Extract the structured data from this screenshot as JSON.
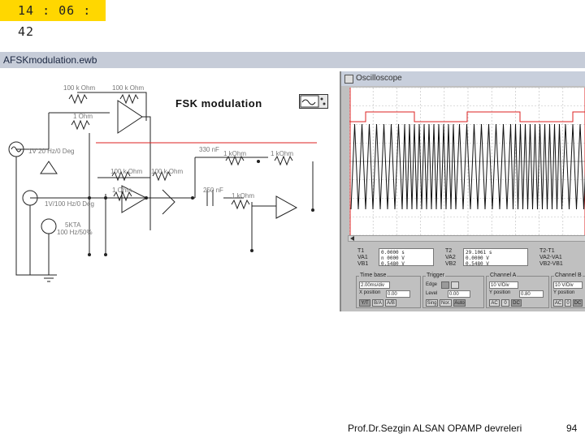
{
  "clock": "14 : 06 : 42",
  "window_title": "AFSKmodulation.ewb",
  "diagram_label": "FSK modulation",
  "components": {
    "r1": "100 k Ohm",
    "r2": "100 k Ohm",
    "r3": "1 Ohm",
    "r4": "1 Ohm",
    "r5": "100 k Ohm",
    "r6": "100 k Ohm",
    "r7": "1 kOhm",
    "r8": "1 kOhm",
    "r9": "1 kOhm",
    "c1": "330 nF",
    "c2": "250 nF",
    "src1": "1V 20 Hz/0 Deg",
    "src2": "1V/100 Hz/0 Deg",
    "clock_src": "5KTA",
    "clock_src2": "100 Hz/50%"
  },
  "scope": {
    "title": "Oscilloscope",
    "readouts": {
      "t1_label": "T1",
      "t2_label": "T2",
      "t2t1_label": "T2-T1",
      "vA1_label": "VA1",
      "vB1_label": "VB1",
      "vA2_label": "VA2",
      "vB2_label": "VB2",
      "vA2A1_label": "VA2-VA1",
      "vB2B1_label": "VB2-VB1",
      "t1_values": [
        "0.0000 s",
        "n 0000 V",
        "0.5480 V"
      ],
      "t2_values": [
        "29.1061 s",
        "0.0000 V",
        "0.5480 V"
      ]
    },
    "timebase": {
      "label": "Time base",
      "value": "2.00ms/div",
      "xpos_label": "X position",
      "xpos": "0.00",
      "buttons": [
        "Y/T",
        "B/A",
        "A/B"
      ]
    },
    "trigger": {
      "label": "Trigger",
      "edge_label": "Edge",
      "level_label": "Level",
      "level": "0.00",
      "buttons": [
        "Sing",
        "Nor.",
        "Auto",
        "A",
        "B",
        "Ext"
      ]
    },
    "channel_a": {
      "label": "Channel A",
      "value": "10 V/Div",
      "ypos_label": "Y position",
      "ypos": "0.80",
      "buttons": [
        "AC",
        "0",
        "DC"
      ]
    },
    "channel_b": {
      "label": "Channel B",
      "value": "10 V/Div",
      "ypos_label": "Y position",
      "ypos": "-2.00",
      "buttons": [
        "AC",
        "0",
        "DC"
      ]
    }
  },
  "footer": "Prof.Dr.Sezgin ALSAN OPAMP devreleri",
  "page_number": "94"
}
